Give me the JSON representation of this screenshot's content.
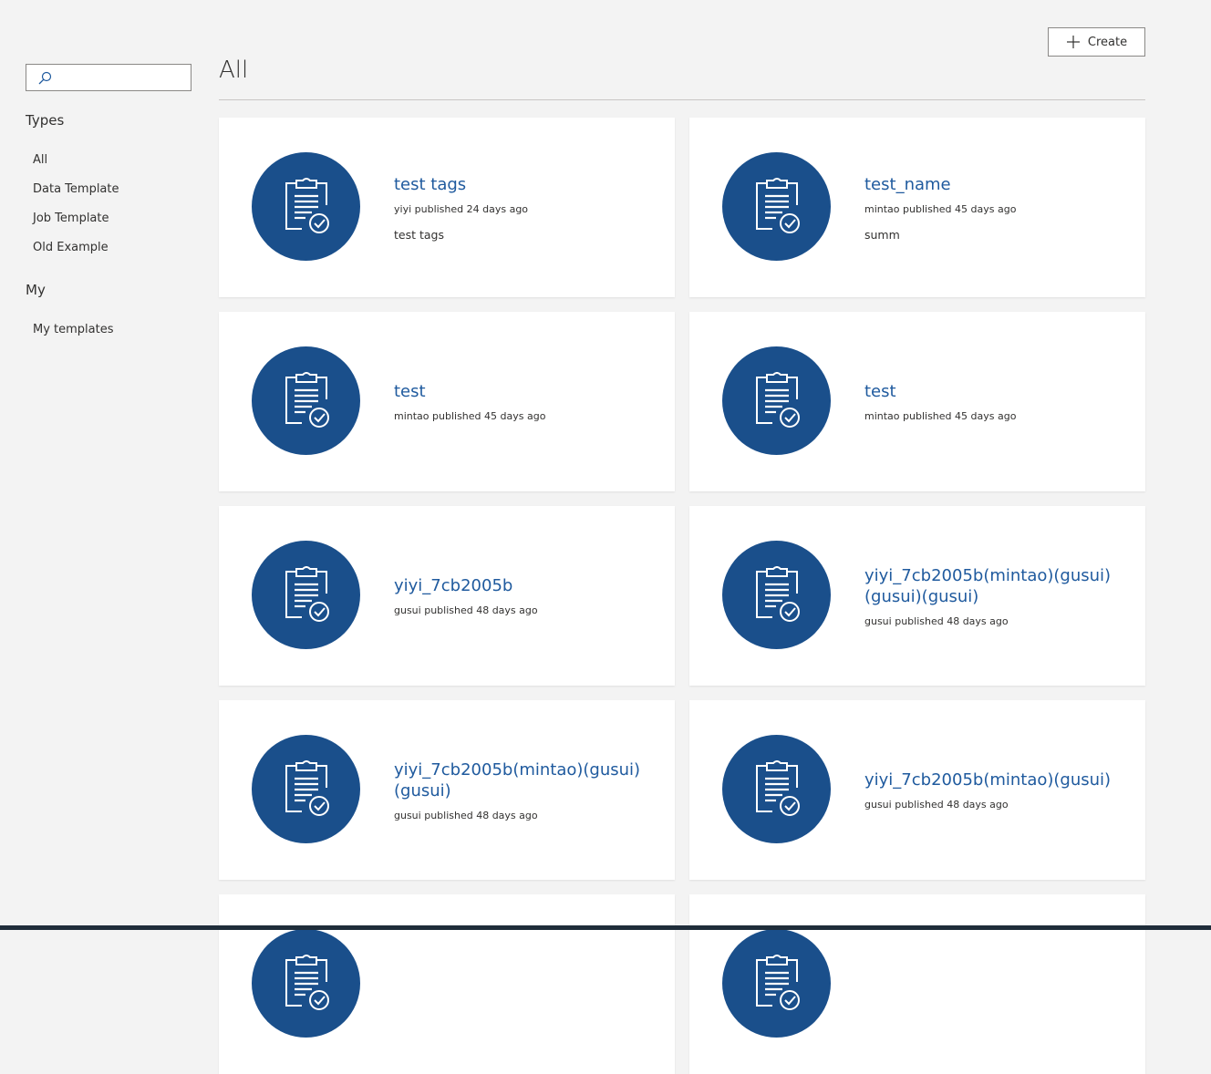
{
  "search": {
    "placeholder": "",
    "value": ""
  },
  "sidebar": {
    "types_heading": "Types",
    "types": [
      {
        "label": "All"
      },
      {
        "label": "Data Template"
      },
      {
        "label": "Job Template"
      },
      {
        "label": "Old Example"
      }
    ],
    "my_heading": "My",
    "my": [
      {
        "label": "My templates"
      }
    ]
  },
  "header": {
    "title": "All",
    "create_label": "Create"
  },
  "cards": [
    {
      "name": "test tags",
      "meta": "yiyi published 24 days ago",
      "desc": "test tags"
    },
    {
      "name": "test_name",
      "meta": "mintao published 45 days ago",
      "desc": "summ"
    },
    {
      "name": "test",
      "meta": "mintao published 45 days ago",
      "desc": ""
    },
    {
      "name": "test",
      "meta": "mintao published 45 days ago",
      "desc": ""
    },
    {
      "name": "yiyi_7cb2005b",
      "meta": "gusui published 48 days ago",
      "desc": ""
    },
    {
      "name": "yiyi_7cb2005b(mintao)(gusui)(gusui)(gusui)",
      "meta": "gusui published 48 days ago",
      "desc": ""
    },
    {
      "name": "yiyi_7cb2005b(mintao)(gusui)(gusui)",
      "meta": "gusui published 48 days ago",
      "desc": ""
    },
    {
      "name": "yiyi_7cb2005b(mintao)(gusui)",
      "meta": "gusui published 48 days ago",
      "desc": ""
    },
    {
      "name": "",
      "meta": "",
      "desc": ""
    },
    {
      "name": "",
      "meta": "",
      "desc": ""
    }
  ],
  "colors": {
    "accent": "#1a4f8b",
    "link": "#1f5a9e",
    "background": "#f3f3f3"
  },
  "icons": {
    "search": "search-icon",
    "create": "plus-icon",
    "card": "clipboard-check-icon"
  }
}
